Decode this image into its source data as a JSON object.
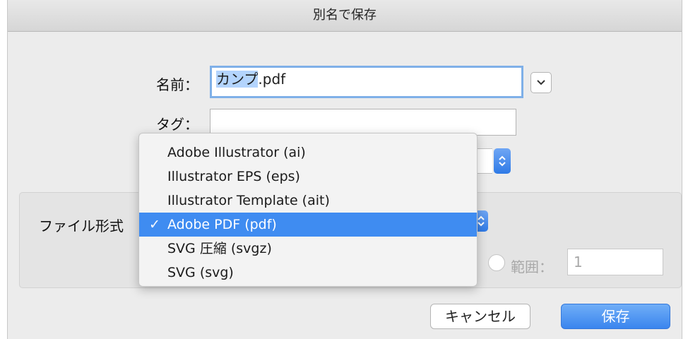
{
  "window": {
    "title": "別名で保存"
  },
  "form": {
    "name_label": "名前：",
    "name_value_selected": "カンプ",
    "name_value_rest": ".pdf",
    "tags_label": "タグ：",
    "tags_value": "",
    "format_label": "ファイル形式"
  },
  "format_menu": {
    "items": [
      {
        "label": "Adobe Illustrator (ai)",
        "checked": false
      },
      {
        "label": "Illustrator EPS (eps)",
        "checked": false
      },
      {
        "label": "Illustrator Template (ait)",
        "checked": false
      },
      {
        "label": "Adobe PDF (pdf)",
        "checked": true
      },
      {
        "label": "SVG 圧縮 (svgz)",
        "checked": false
      },
      {
        "label": "SVG (svg)",
        "checked": false
      }
    ],
    "check_mark": "✓"
  },
  "range": {
    "label": "範囲：",
    "value": "1"
  },
  "buttons": {
    "cancel": "キャンセル",
    "save": "保存"
  },
  "colors": {
    "accent": "#3f8cf1",
    "selection": "#b3d4fd"
  }
}
